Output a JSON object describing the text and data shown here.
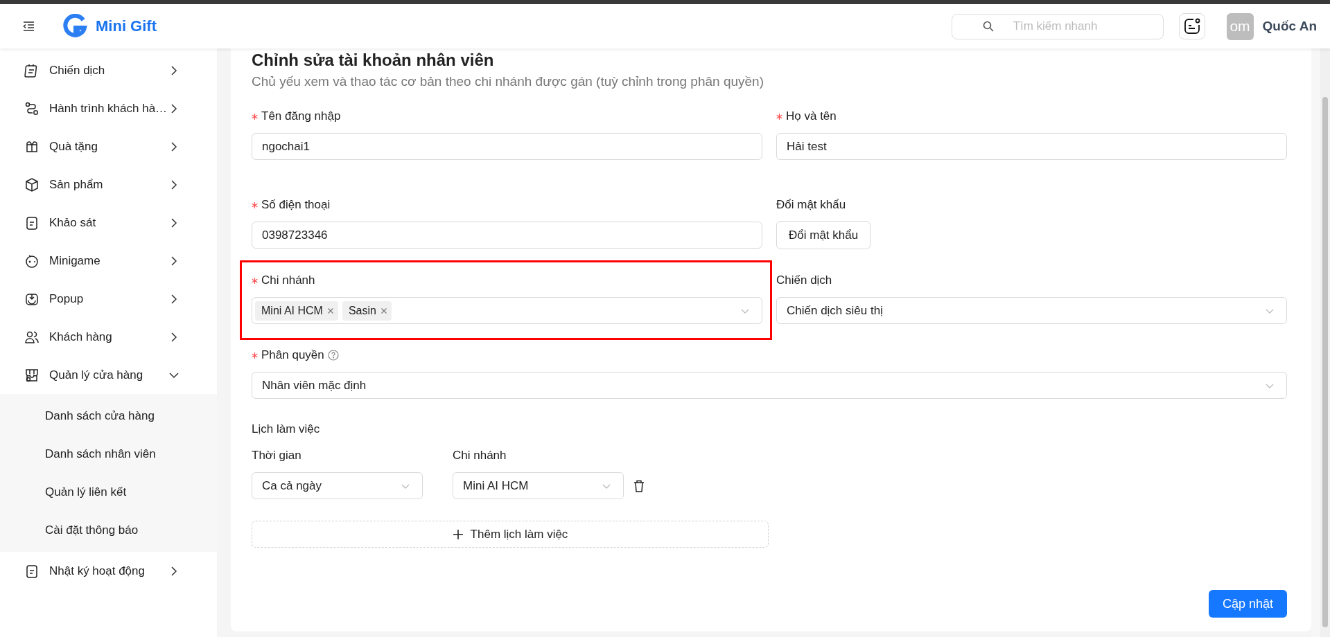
{
  "header": {
    "brand": "Mini Gift",
    "search": {
      "placeholder": "Tìm kiếm nhanh"
    },
    "avatar_text": "om",
    "user_name": "Quốc An"
  },
  "sidebar": {
    "items": [
      {
        "label": "Chiến dịch",
        "expanded": false
      },
      {
        "label": "Hành trình khách hà…",
        "expanded": false
      },
      {
        "label": "Quà tặng",
        "expanded": false
      },
      {
        "label": "Sản phẩm",
        "expanded": false
      },
      {
        "label": "Khảo sát",
        "expanded": false
      },
      {
        "label": "Minigame",
        "expanded": false
      },
      {
        "label": "Popup",
        "expanded": false
      },
      {
        "label": "Khách hàng",
        "expanded": false
      },
      {
        "label": "Quản lý cửa hàng",
        "expanded": true,
        "children": [
          {
            "label": "Danh sách cửa hàng"
          },
          {
            "label": "Danh sách nhân viên"
          },
          {
            "label": "Quản lý liên kết"
          },
          {
            "label": "Cài đặt thông báo"
          }
        ]
      },
      {
        "label": "Nhật ký hoạt động",
        "expanded": false
      }
    ]
  },
  "form": {
    "title": "Chỉnh sửa tài khoản nhân viên",
    "subtitle": "Chủ yếu xem và thao tác cơ bản theo chi nhánh được gán (tuỳ chỉnh trong phân quyền)",
    "rows": [
      [
        {
          "kind": "input",
          "label": "Tên đăng nhập",
          "required": true,
          "value": "ngochai1"
        },
        {
          "kind": "input",
          "label": "Họ và tên",
          "required": true,
          "value": "Hải test"
        }
      ],
      [
        {
          "kind": "input",
          "label": "Số điện thoại",
          "required": true,
          "value": "0398723346"
        },
        {
          "kind": "button",
          "label": "Đổi mật khẩu",
          "required": false,
          "button_label": "Đổi mật khẩu"
        }
      ],
      [
        {
          "kind": "tags",
          "label": "Chi nhánh",
          "required": true,
          "highlighted": true,
          "tags": [
            "Mini AI HCM",
            "Sasin"
          ]
        },
        {
          "kind": "select",
          "label": "Chiến dịch",
          "required": false,
          "value": "Chiến dịch siêu thị"
        }
      ],
      [
        {
          "kind": "select",
          "label": "Phân quyền",
          "required": true,
          "help": true,
          "value": "Nhân viên mặc định"
        }
      ]
    ]
  },
  "schedule": {
    "title": "Lịch làm việc",
    "columns": [
      "Thời gian",
      "Chi nhánh"
    ],
    "entries": [
      {
        "time": "Ca cả ngày",
        "branch": "Mini AI HCM"
      }
    ],
    "add_label": "Thêm lịch làm việc"
  },
  "submit": "Cập nhật"
}
